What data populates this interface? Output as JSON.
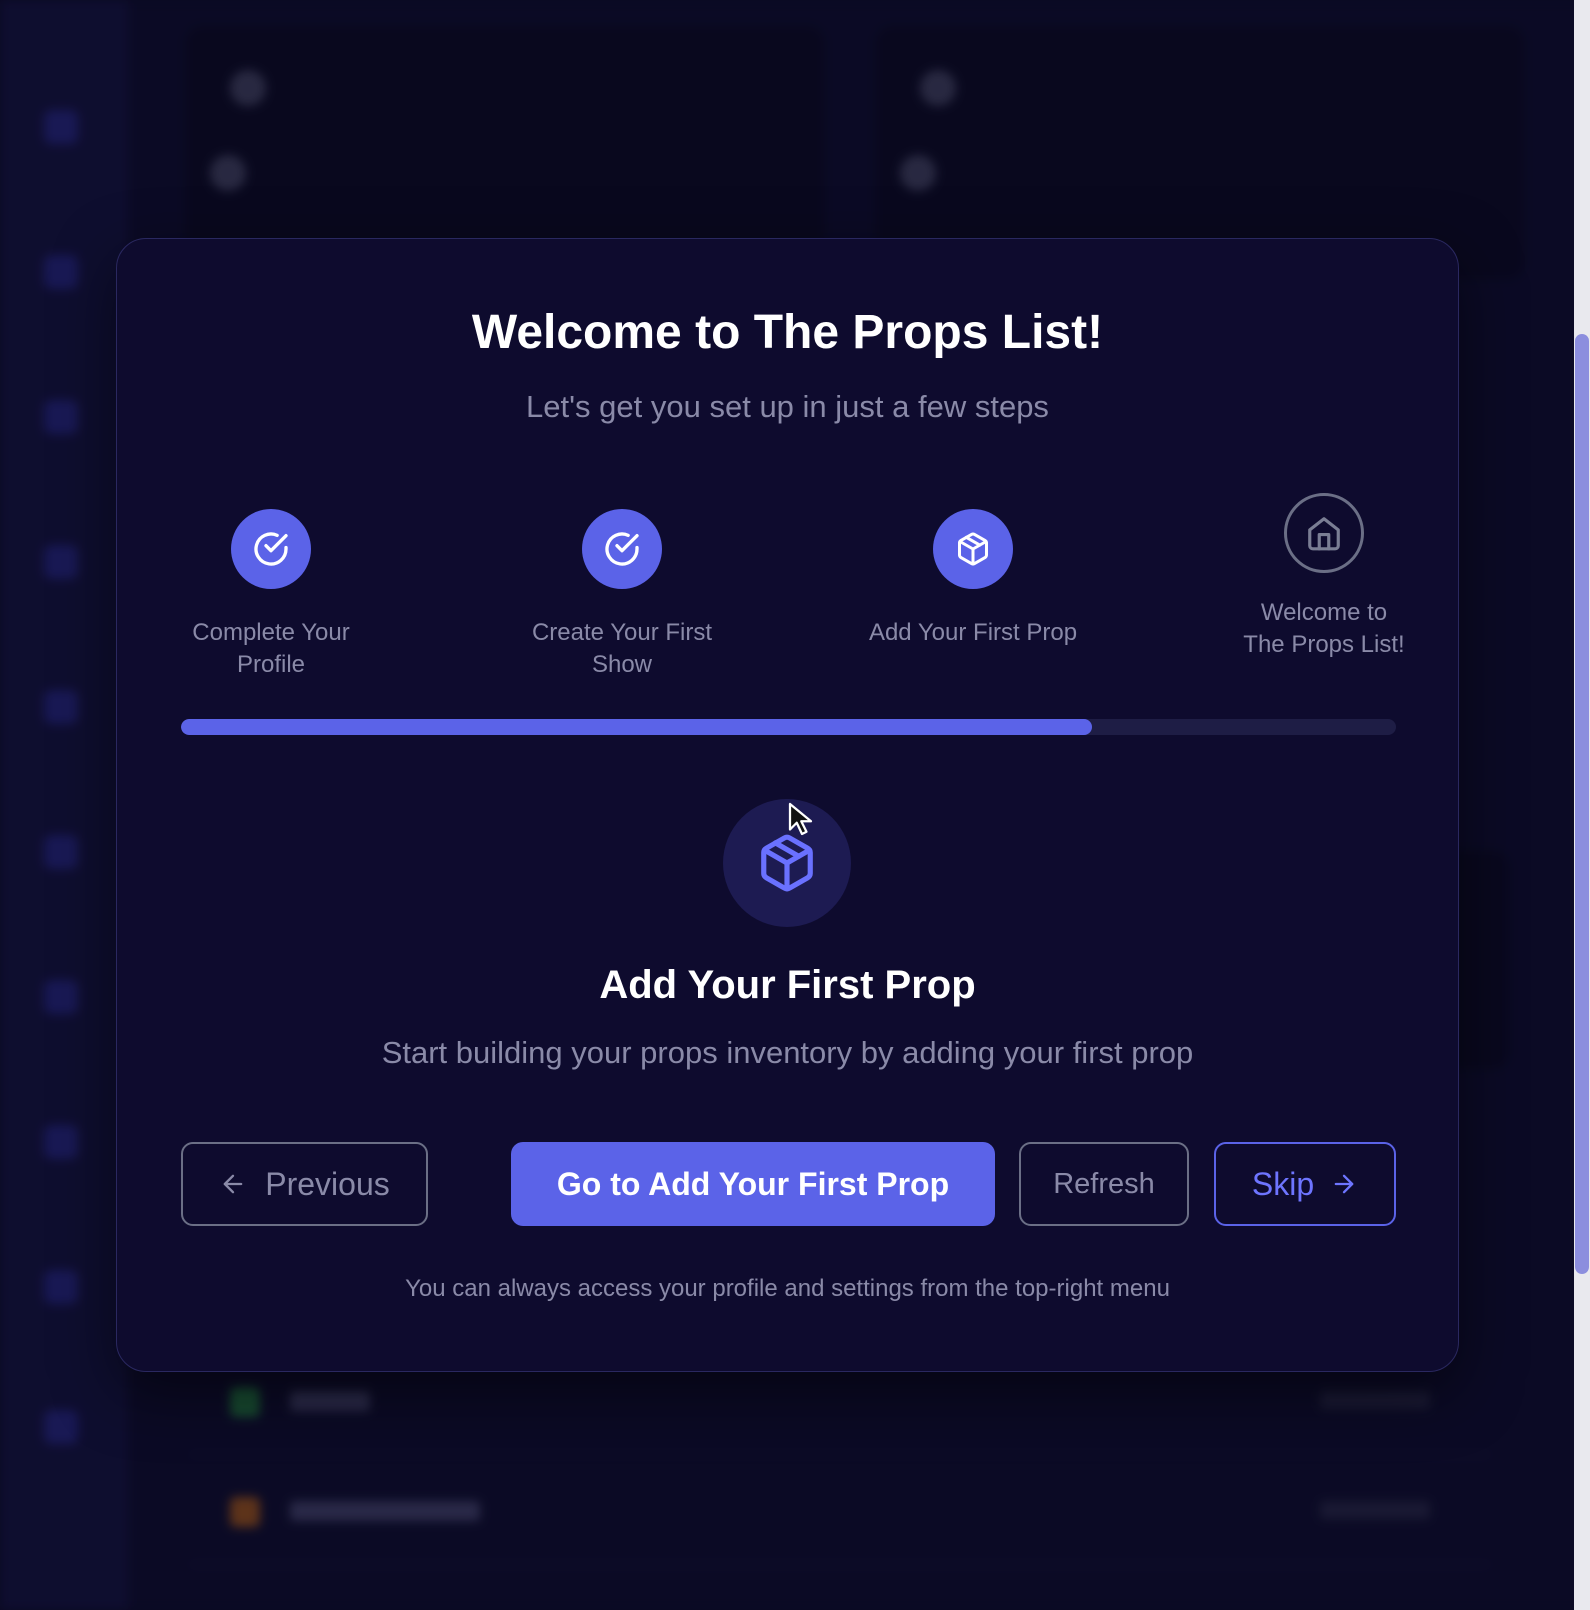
{
  "modal": {
    "title": "Welcome to The Props List!",
    "subtitle": "Let's get you set up in just a few steps",
    "steps": [
      {
        "label": "Complete Your Profile",
        "state": "completed",
        "icon": "check-circle-icon"
      },
      {
        "label": "Create Your First Show",
        "state": "completed",
        "icon": "check-circle-icon"
      },
      {
        "label": "Add Your First Prop",
        "state": "current",
        "icon": "package-icon"
      },
      {
        "label": "Welcome to The Props List!",
        "state": "pending",
        "icon": "home-icon"
      }
    ],
    "progress_fraction": 0.75,
    "current_step": {
      "icon": "package-icon",
      "title": "Add Your First Prop",
      "description": "Start building your props inventory by adding your first prop"
    },
    "buttons": {
      "previous": "Previous",
      "primary": "Go to Add Your First Prop",
      "refresh": "Refresh",
      "skip": "Skip"
    },
    "footer_note": "You can always access your profile and settings from the top-right menu"
  },
  "colors": {
    "accent": "#5b63e8",
    "background": "#0e0b2e",
    "muted_text": "#8a8aa8"
  }
}
